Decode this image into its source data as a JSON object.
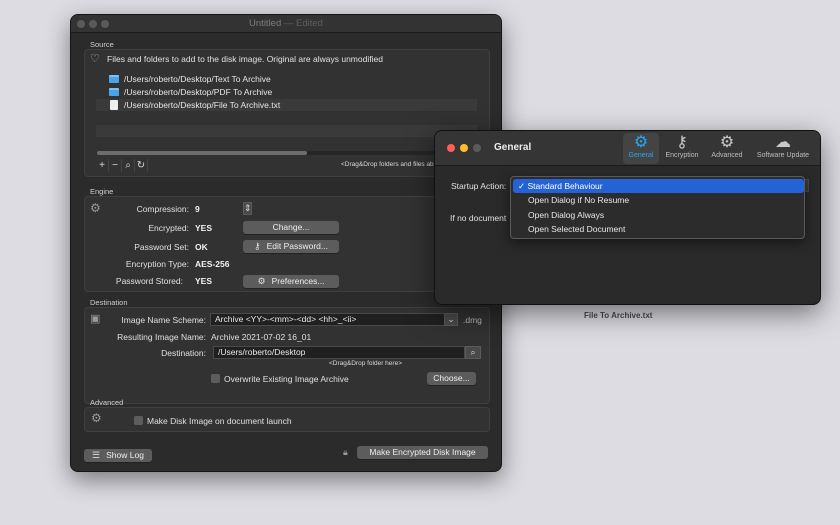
{
  "window": {
    "title": "Untitled",
    "edited": "— Edited"
  },
  "source": {
    "label": "Source",
    "note": "Files and folders to add to the disk image. Original are always unmodified",
    "items": [
      {
        "path": "/Users/roberto/Desktop/Text To Archive",
        "icon": "folder-icon"
      },
      {
        "path": "/Users/roberto/Desktop/PDF To Archive",
        "icon": "folder-icon"
      },
      {
        "path": "/Users/roberto/Desktop/File To Archive.txt",
        "icon": "document-icon"
      }
    ],
    "tools": [
      "+",
      "−",
      "⌕",
      "↻"
    ],
    "drag_hint": "<Drag&Drop folders and files above>"
  },
  "engine": {
    "label": "Engine",
    "compression_label": "Compression:",
    "compression_value": "9",
    "encrypted_label": "Encrypted:",
    "encrypted_value": "YES",
    "change_button": "Change...",
    "password_set_label": "Password Set:",
    "password_set_value": "OK",
    "edit_password_button": "Edit Password...",
    "encryption_type_label": "Encryption Type:",
    "encryption_type_value": "AES-256",
    "password_stored_label": "Password  Stored:",
    "password_stored_value": "YES",
    "preferences_button": "Preferences..."
  },
  "destination": {
    "label": "Destination",
    "scheme_label": "Image Name Scheme:",
    "scheme_value": "Archive <YY>-<mm>-<dd> <hh>_<ii>",
    "scheme_ext": ".dmg",
    "resulting_label": "Resulting Image Name:",
    "resulting_value": "Archive 2021-07-02 16_01",
    "destination_label": "Destination:",
    "destination_value": "/Users/roberto/Desktop",
    "drag_hint": "<Drag&Drop folder here>",
    "overwrite_label": "Overwrite Existing Image Archive",
    "choose_button": "Choose..."
  },
  "advanced": {
    "label": "Advanced",
    "launch_label": "Make Disk Image on document launch"
  },
  "footer": {
    "show_log_button": "Show Log",
    "make_button": "Make Encrypted Disk Image"
  },
  "preferences": {
    "title": "General",
    "tabs": [
      {
        "label": "General",
        "icon": "gear-icon",
        "active": true
      },
      {
        "label": "Encryption",
        "icon": "key-icon",
        "active": false
      },
      {
        "label": "Advanced",
        "icon": "gears-icon",
        "active": false
      },
      {
        "label": "Software Update",
        "icon": "cloud-icon",
        "active": false
      }
    ],
    "startup_label": "Startup Action:",
    "no_document_label": "If no document",
    "menu_options": [
      "Standard Behaviour",
      "Open Dialog if No Resume",
      "Open Dialog Always",
      "Open Selected Document"
    ],
    "selected_option": "Standard Behaviour"
  },
  "desktop": {
    "file_label": "File To Archive.txt"
  },
  "colors": {
    "accent": "#27a7f0",
    "selection": "#2463d6",
    "close": "#ff5f57",
    "minimize": "#febc2e",
    "inactive": "#5a5a5a"
  }
}
